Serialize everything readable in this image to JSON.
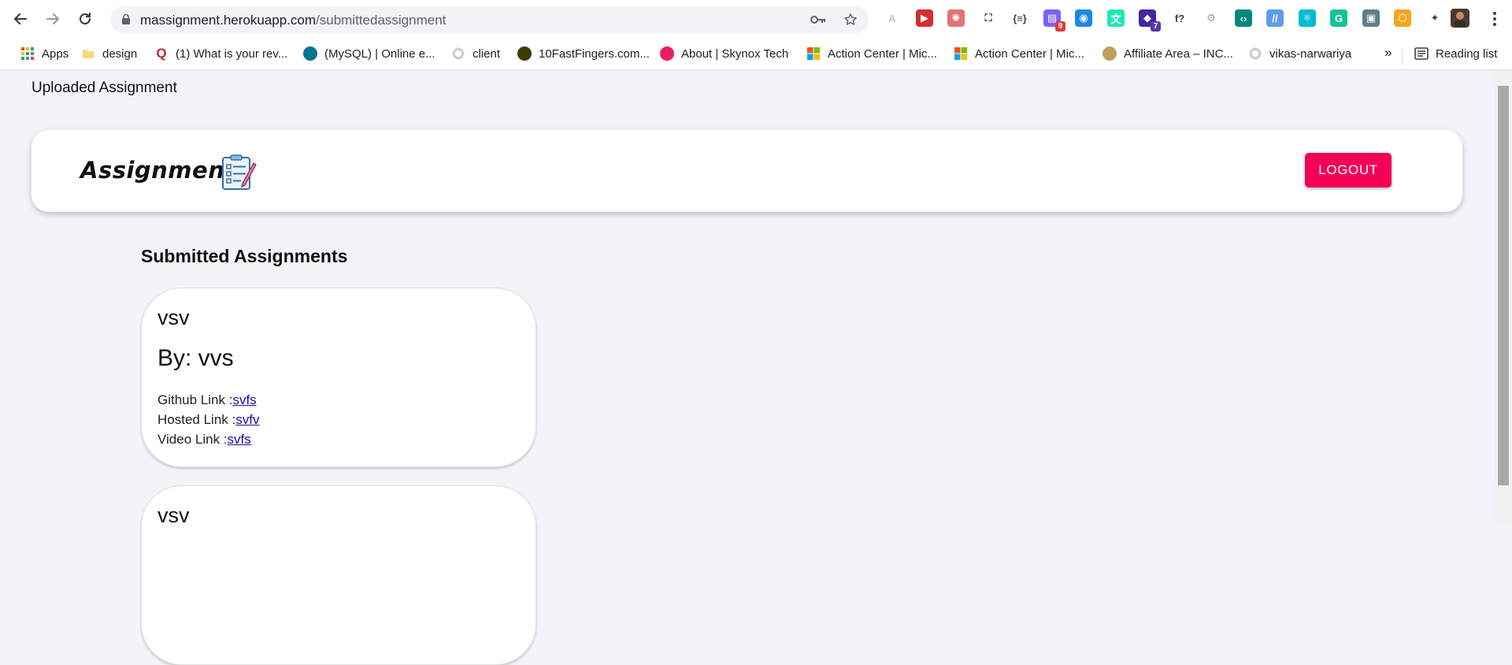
{
  "browser": {
    "url_host": "massignment.herokuapp.com",
    "url_path": "/submittedassignment",
    "extensions": [
      {
        "name": "angular-devtools-icon",
        "color": "#c7c7c7",
        "glyph": "A",
        "badge": ""
      },
      {
        "name": "video-speed-icon",
        "color": "#d32f2f",
        "glyph": "▶",
        "badge": ""
      },
      {
        "name": "color-picker-icon",
        "color": "#e57373",
        "glyph": "✺",
        "badge": ""
      },
      {
        "name": "screenshot-icon",
        "color": "#3c4043",
        "glyph": "⛶",
        "badge": ""
      },
      {
        "name": "json-viewer-icon",
        "color": "#3c4043",
        "glyph": "{≡}",
        "badge": ""
      },
      {
        "name": "tab-manager-icon",
        "color": "#7b61ff",
        "glyph": "▤",
        "badge": "9"
      },
      {
        "name": "mask-icon",
        "color": "#1e88e5",
        "glyph": "◉",
        "badge": ""
      },
      {
        "name": "translate-icon",
        "color": "#1de9b6",
        "glyph": "文",
        "badge": ""
      },
      {
        "name": "academic-cap-icon",
        "color": "#4527a0",
        "glyph": "◆",
        "badge": "7"
      },
      {
        "name": "function-icon",
        "color": "#3c4043",
        "glyph": "f?",
        "badge": ""
      },
      {
        "name": "gear-extension-icon",
        "color": "#9e9e9e",
        "glyph": "⚙",
        "badge": ""
      },
      {
        "name": "code-icon",
        "color": "#00897b",
        "glyph": "‹›",
        "badge": ""
      },
      {
        "name": "rest-client-icon",
        "color": "#5c9ded",
        "glyph": "//",
        "badge": ""
      },
      {
        "name": "react-devtools-icon",
        "color": "#00bcd4",
        "glyph": "⚛",
        "badge": ""
      },
      {
        "name": "grammarly-icon",
        "color": "#15c39a",
        "glyph": "G",
        "badge": ""
      },
      {
        "name": "id-card-icon",
        "color": "#607d8b",
        "glyph": "▣",
        "badge": ""
      },
      {
        "name": "hexagon-extension-icon",
        "color": "#f5a623",
        "glyph": "⬡",
        "badge": ""
      },
      {
        "name": "puzzle-extensions-icon",
        "color": "#3c4043",
        "glyph": "✦",
        "badge": ""
      }
    ],
    "bookmarks": [
      {
        "label": "Apps",
        "icon": "apps-grid-icon",
        "color": "#ea4335"
      },
      {
        "label": "design",
        "icon": "folder-icon",
        "color": "#f8d775"
      },
      {
        "label": "(1) What is your rev...",
        "icon": "quora-icon",
        "color": "#b92b27"
      },
      {
        "label": "(MySQL) | Online e...",
        "icon": "mysql-site-icon",
        "color": "#00758f"
      },
      {
        "label": "client",
        "icon": "github-icon",
        "color": "#c0c0c0"
      },
      {
        "label": "10FastFingers.com...",
        "icon": "tenfastfingers-icon",
        "color": "#3b3b00"
      },
      {
        "label": "About | Skynox Tech",
        "icon": "skynox-icon",
        "color": "#e91e63"
      },
      {
        "label": "Action Center | Mic...",
        "icon": "microsoft-icon",
        "color": "#f25022"
      },
      {
        "label": "Action Center | Mic...",
        "icon": "microsoft-icon",
        "color": "#f25022"
      },
      {
        "label": "Affiliate Area – INC...",
        "icon": "affiliate-icon",
        "color": "#c0a060"
      },
      {
        "label": "vikas-narwariya",
        "icon": "github-icon",
        "color": "#c0c0c0"
      }
    ],
    "bookmarks_more": "»",
    "reading_list": "Reading list"
  },
  "page": {
    "heading": "Uploaded Assignment",
    "logo_text": "Assignment",
    "logout_label": "LOGOUT",
    "section_title": "Submitted Assignments",
    "assignments": [
      {
        "title": "vsv",
        "by": "By: vvs",
        "github_label": "Github Link :",
        "github_link": "svfs",
        "hosted_label": "Hosted Link :",
        "hosted_link": "svfv",
        "video_label": "Video Link :",
        "video_link": "svfs"
      },
      {
        "title": "vsv"
      }
    ]
  },
  "colors": {
    "accent": "#f50057",
    "link": "#1a0dab",
    "page_bg": "#f4f4f8"
  }
}
